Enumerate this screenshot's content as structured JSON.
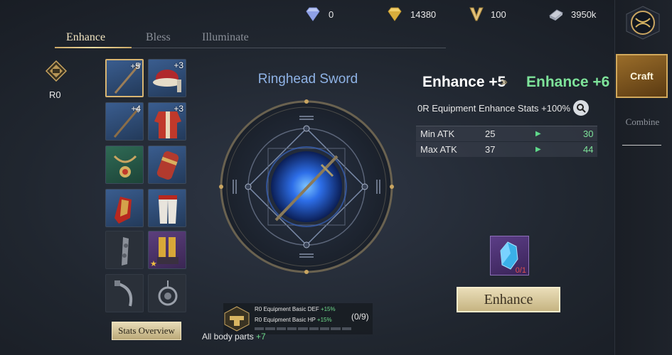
{
  "currency": [
    {
      "icon": "diamond-icon",
      "value": "0"
    },
    {
      "icon": "gold-gem-icon",
      "value": "14380"
    },
    {
      "icon": "valor-icon",
      "value": "100"
    },
    {
      "icon": "silver-bar-icon",
      "value": "3950k"
    }
  ],
  "tabs": [
    "Enhance",
    "Bless",
    "Illuminate"
  ],
  "active_tab": "Enhance",
  "rank": {
    "label": "R0"
  },
  "items": [
    {
      "kind": "spear",
      "level": "+5",
      "rarity": "blue",
      "selected": true
    },
    {
      "kind": "hat",
      "level": "+3",
      "rarity": "blue"
    },
    {
      "kind": "spear",
      "level": "+4",
      "rarity": "blue"
    },
    {
      "kind": "robe",
      "level": "+3",
      "rarity": "blue"
    },
    {
      "kind": "amulet",
      "level": "",
      "rarity": "green"
    },
    {
      "kind": "bracer",
      "level": "",
      "rarity": "blue"
    },
    {
      "kind": "gauntlet",
      "level": "",
      "rarity": "blue"
    },
    {
      "kind": "pants",
      "level": "",
      "rarity": "blue"
    },
    {
      "kind": "ornament",
      "level": "",
      "rarity": "empty"
    },
    {
      "kind": "boots",
      "level": "",
      "rarity": "purple",
      "starred": true
    },
    {
      "kind": "dagger",
      "level": "",
      "rarity": "empty"
    },
    {
      "kind": "medallion",
      "level": "",
      "rarity": "empty"
    }
  ],
  "stats_overview_label": "Stats Overview",
  "item_name": "Ringhead Sword",
  "enhance": {
    "from": "Enhance +5",
    "to": "Enhance +6",
    "description": "0R Equipment Enhance Stats +100%",
    "stats": [
      {
        "label": "Min ATK",
        "current": "25",
        "next": "30"
      },
      {
        "label": "Max ATK",
        "current": "37",
        "next": "44"
      }
    ]
  },
  "material": {
    "count": "0/1"
  },
  "enhance_button": "Enhance",
  "sidebar": {
    "craft": "Craft",
    "combine": "Combine"
  },
  "bonus": {
    "line1_text": "R0 Equipment Basic DEF",
    "line1_value": "+15%",
    "line2_text": "R0 Equipment Basic HP",
    "line2_value": "+15%",
    "progress": "(0/9)",
    "progress_fraction": 0
  },
  "all_body_parts": {
    "label": "All body parts",
    "value": "+7"
  },
  "colors": {
    "accent_gold": "#d8b572",
    "stat_up_green": "#7ee39a",
    "item_name_blue": "#8fb3e6"
  }
}
